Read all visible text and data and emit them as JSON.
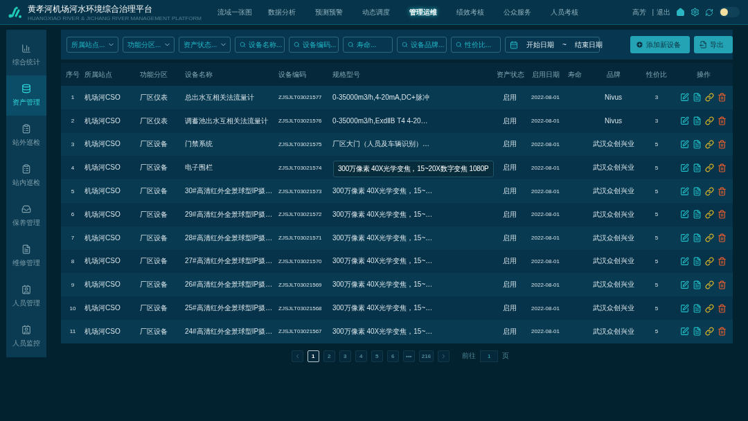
{
  "header": {
    "title": "黄孝河机场河水环境综合治理平台",
    "subtitle": "HUANGXIAO RIVER & JICHANG RIVER MANAGEMENT PLATFORM",
    "nav": [
      {
        "label": "流域一张图",
        "selected": false
      },
      {
        "label": "数据分析",
        "selected": false
      },
      {
        "label": "预测预警",
        "selected": false
      },
      {
        "label": "动态调度",
        "selected": false
      },
      {
        "label": "管理运维",
        "selected": true
      },
      {
        "label": "绩效考核",
        "selected": false
      },
      {
        "label": "公众服务",
        "selected": false
      },
      {
        "label": "人员考核",
        "selected": false
      }
    ],
    "user": "高芳",
    "separator": "|",
    "logout": "退出",
    "light_mode": false
  },
  "sidebar": {
    "items": [
      {
        "label": "综合统计",
        "selected": false
      },
      {
        "label": "资产管理",
        "selected": true
      },
      {
        "label": "站外巡检",
        "selected": false
      },
      {
        "label": "站内巡检",
        "selected": false
      },
      {
        "label": "保养管理",
        "selected": false
      },
      {
        "label": "维修管理",
        "selected": false
      },
      {
        "label": "人员管理",
        "selected": false
      },
      {
        "label": "人员监控",
        "selected": false
      }
    ]
  },
  "filters": [
    {
      "kind": "select",
      "placeholder": "所属站点..."
    },
    {
      "kind": "select",
      "placeholder": "功能分区..."
    },
    {
      "kind": "select",
      "placeholder": "资产状态..."
    },
    {
      "kind": "search",
      "placeholder": "设备名称..."
    },
    {
      "kind": "search",
      "placeholder": "设备编码..."
    },
    {
      "kind": "search",
      "placeholder": "寿命..."
    },
    {
      "kind": "search",
      "placeholder": "设备品牌..."
    },
    {
      "kind": "search",
      "placeholder": "性价比..."
    },
    {
      "kind": "date",
      "start": "开始日期",
      "separator": "~",
      "end": "结束日期"
    }
  ],
  "actions": [
    {
      "kind": "add",
      "label": "添加新设备"
    },
    {
      "kind": "export",
      "label": "导出"
    }
  ],
  "table": {
    "columns": [
      "序号",
      "所属站点",
      "功能分区",
      "设备名称",
      "设备编码",
      "规格型号",
      "资产状态",
      "启用日期",
      "寿命",
      "品牌",
      "性价比",
      "操作"
    ],
    "rows": [
      {
        "no": "1",
        "station": "机场河CSO",
        "zone": "厂区仪表",
        "name": "总出水互相关法流量计",
        "code": "ZJSJLT03021577",
        "spec": "0-35000m3/h,4-20mA,DC+脉冲",
        "status": "启用",
        "date": "2022-08-01",
        "brand": "Nivus",
        "ratio": "3"
      },
      {
        "no": "2",
        "station": "机场河CSO",
        "zone": "厂区仪表",
        "name": "调蓄池出水互相关法流量计",
        "code": "ZJSJLT03021576",
        "spec": "0-35000m3/h,ExdⅡB T4 4-20…",
        "status": "启用",
        "date": "2022-08-01",
        "brand": "Nivus",
        "ratio": "3"
      },
      {
        "no": "3",
        "station": "机场河CSO",
        "zone": "厂区设备",
        "name": "门禁系统",
        "code": "ZJSJLT03021575",
        "spec": "厂区大门（人员及车辆识别）…",
        "status": "启用",
        "date": "2022-08-01",
        "brand": "武汉众创兴业",
        "ratio": "5"
      },
      {
        "no": "4",
        "station": "机场河CSO",
        "zone": "厂区设备",
        "name": "电子围栏",
        "code": "ZJSJLT03021574",
        "tooltip": "300万像素 40X光学变焦，15~20X数字变焦 1080P",
        "status": "启用",
        "date": "2022-08-01",
        "brand": "武汉众创兴业",
        "ratio": "5"
      },
      {
        "no": "5",
        "station": "机场河CSO",
        "zone": "厂区设备",
        "name": "30#高清红外全景球型IP摄…",
        "code": "ZJSJLT03021573",
        "spec": "300万像素 40X光学变焦，15~…",
        "status": "启用",
        "date": "2022-08-01",
        "brand": "武汉众创兴业",
        "ratio": "5"
      },
      {
        "no": "6",
        "station": "机场河CSO",
        "zone": "厂区设备",
        "name": "29#高清红外全景球型IP摄…",
        "code": "ZJSJLT03021572",
        "spec": "300万像素 40X光学变焦，15~…",
        "status": "启用",
        "date": "2022-08-01",
        "brand": "武汉众创兴业",
        "ratio": "5"
      },
      {
        "no": "7",
        "station": "机场河CSO",
        "zone": "厂区设备",
        "name": "28#高清红外全景球型IP摄…",
        "code": "ZJSJLT03021571",
        "spec": "300万像素 40X光学变焦，15~…",
        "status": "启用",
        "date": "2022-08-01",
        "brand": "武汉众创兴业",
        "ratio": "5"
      },
      {
        "no": "8",
        "station": "机场河CSO",
        "zone": "厂区设备",
        "name": "27#高清红外全景球型IP摄…",
        "code": "ZJSJLT03021570",
        "spec": "300万像素 40X光学变焦，15~…",
        "status": "启用",
        "date": "2022-08-01",
        "brand": "武汉众创兴业",
        "ratio": "5"
      },
      {
        "no": "9",
        "station": "机场河CSO",
        "zone": "厂区设备",
        "name": "26#高清红外全景球型IP摄…",
        "code": "ZJSJLT03021569",
        "spec": "300万像素 40X光学变焦，15~…",
        "status": "启用",
        "date": "2022-08-01",
        "brand": "武汉众创兴业",
        "ratio": "5"
      },
      {
        "no": "10",
        "station": "机场河CSO",
        "zone": "厂区设备",
        "name": "25#高清红外全景球型IP摄…",
        "code": "ZJSJLT03021568",
        "spec": "300万像素 40X光学变焦，15~…",
        "status": "启用",
        "date": "2022-08-01",
        "brand": "武汉众创兴业",
        "ratio": "5"
      },
      {
        "no": "11",
        "station": "机场河CSO",
        "zone": "厂区设备",
        "name": "24#高清红外全景球型IP摄…",
        "code": "ZJSJLT03021567",
        "spec": "300万像素 40X光学变焦，15~…",
        "status": "启用",
        "date": "2022-08-01",
        "brand": "武汉众创兴业",
        "ratio": "5"
      }
    ]
  },
  "pagination": {
    "pages": [
      {
        "label": "1",
        "selected": true
      },
      {
        "label": "2",
        "selected": false
      },
      {
        "label": "3",
        "selected": false
      },
      {
        "label": "4",
        "selected": false
      },
      {
        "label": "5",
        "selected": false
      },
      {
        "label": "6",
        "selected": false
      },
      {
        "label": "•••",
        "selected": false
      },
      {
        "label": "216",
        "selected": false
      }
    ],
    "goto_label": "前往",
    "goto_value": "1",
    "page_unit": "页"
  }
}
